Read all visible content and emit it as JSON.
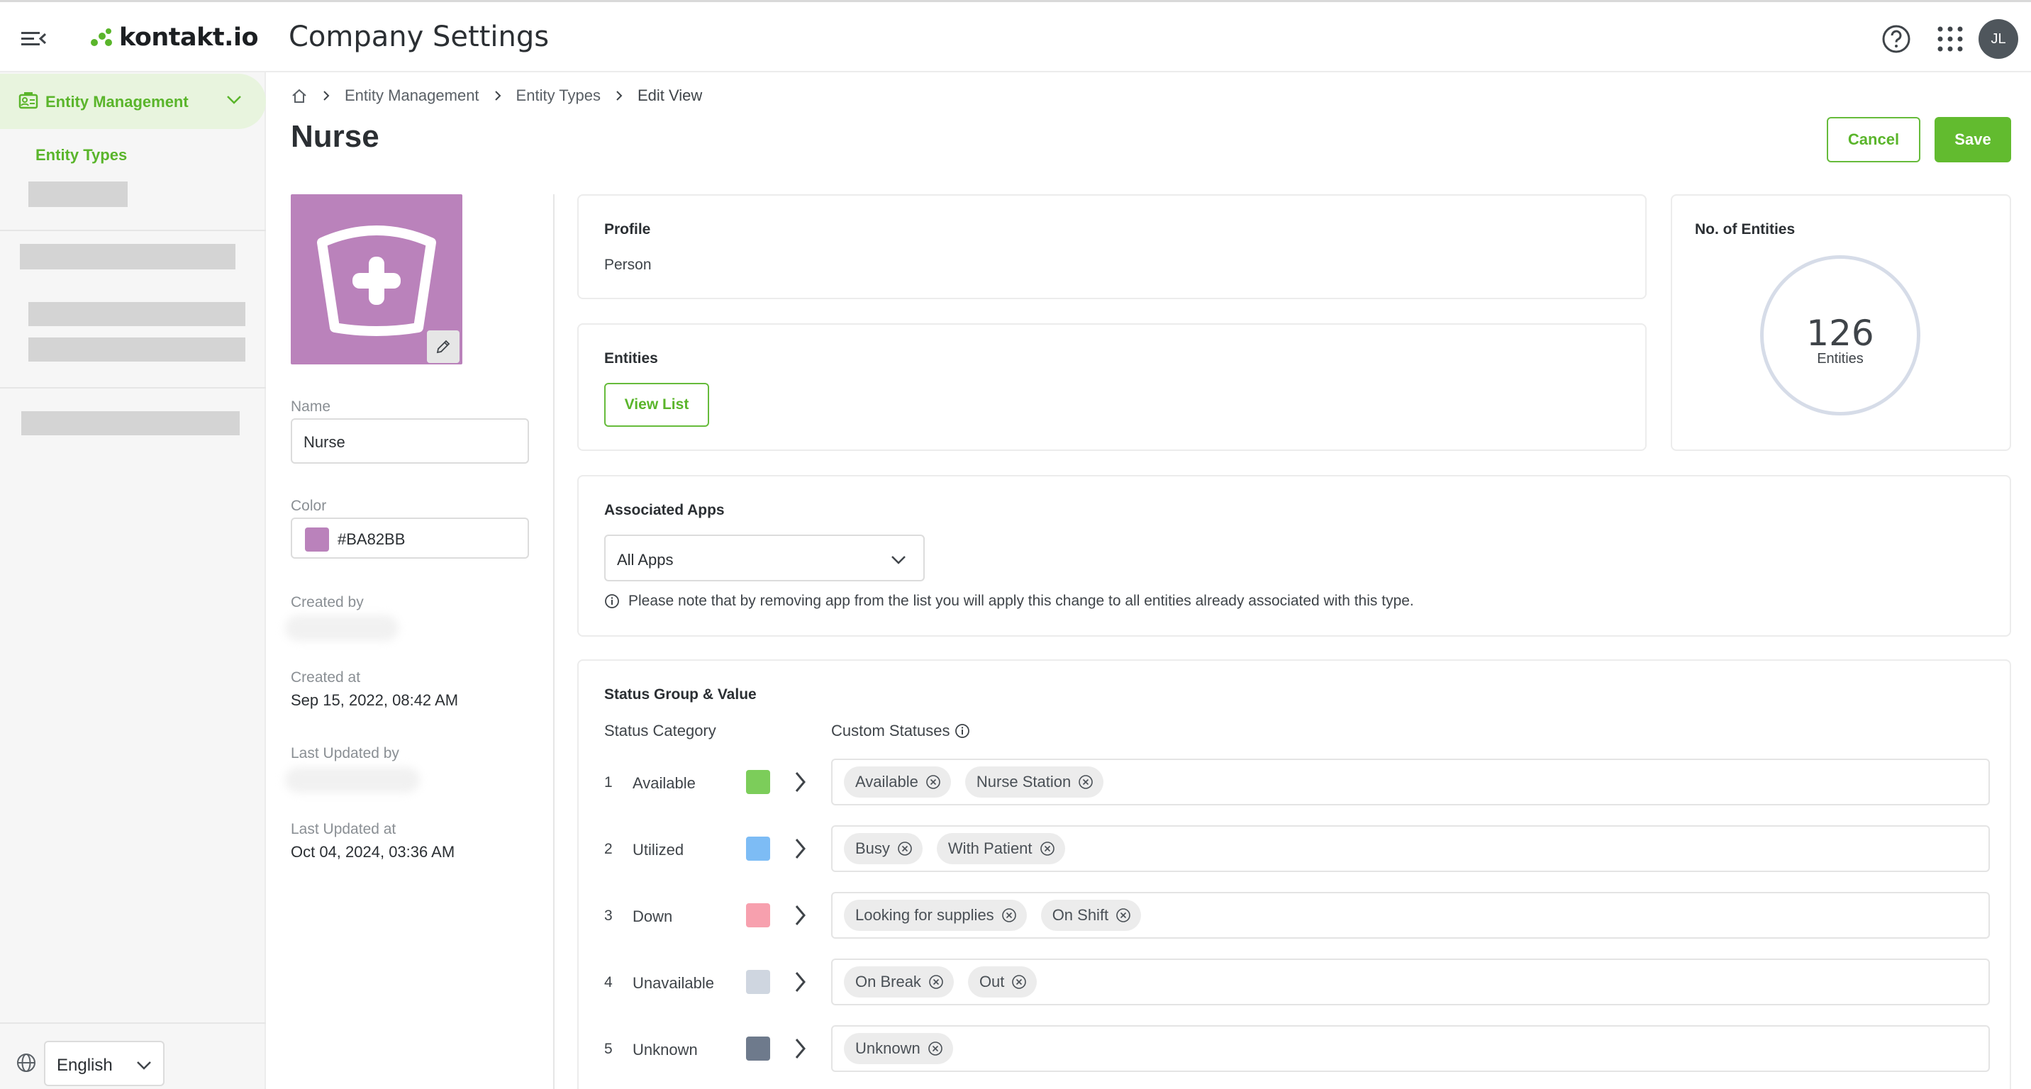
{
  "header": {
    "logo_text": "kontakt.io",
    "app_title": "Company Settings",
    "avatar_initials": "JL"
  },
  "sidebar": {
    "active_section": "Entity Management",
    "sub_item": "Entity Types",
    "language": "English"
  },
  "breadcrumb": {
    "items": [
      "Entity Management",
      "Entity Types",
      "Edit View"
    ]
  },
  "page": {
    "title": "Nurse",
    "cancel_label": "Cancel",
    "save_label": "Save"
  },
  "entity": {
    "icon_color": "#BA82BB",
    "name_label": "Name",
    "name_value": "Nurse",
    "color_label": "Color",
    "color_value": "#BA82BB",
    "created_by_label": "Created by",
    "created_at_label": "Created at",
    "created_at_value": "Sep 15, 2022, 08:42 AM",
    "last_updated_by_label": "Last Updated by",
    "last_updated_at_label": "Last Updated at",
    "last_updated_at_value": "Oct 04, 2024, 03:36 AM"
  },
  "profile_card": {
    "title": "Profile",
    "value": "Person"
  },
  "entities_card": {
    "title": "Entities",
    "button_label": "View List"
  },
  "count_card": {
    "title": "No. of Entities",
    "count": "126",
    "unit": "Entities"
  },
  "apps_card": {
    "title": "Associated Apps",
    "selected": "All Apps",
    "note": "Please note that by removing app from the list you will apply this change to all entities already associated with this type."
  },
  "status_card": {
    "title": "Status Group & Value",
    "col_category": "Status Category",
    "col_custom": "Custom Statuses",
    "rows": [
      {
        "num": "1",
        "name": "Available",
        "color": "#7ccd5a",
        "chips": [
          "Available",
          "Nurse Station"
        ]
      },
      {
        "num": "2",
        "name": "Utilized",
        "color": "#7dbcf5",
        "chips": [
          "Busy",
          "With Patient"
        ]
      },
      {
        "num": "3",
        "name": "Down",
        "color": "#f7a0ae",
        "chips": [
          "Looking for supplies",
          "On Shift"
        ]
      },
      {
        "num": "4",
        "name": "Unavailable",
        "color": "#cfd6e0",
        "chips": [
          "On Break",
          "Out"
        ]
      },
      {
        "num": "5",
        "name": "Unknown",
        "color": "#6e7a8c",
        "chips": [
          "Unknown"
        ]
      }
    ]
  },
  "colors": {
    "brand_green": "#62bb2f",
    "accent_green_text": "#5ab52b"
  }
}
